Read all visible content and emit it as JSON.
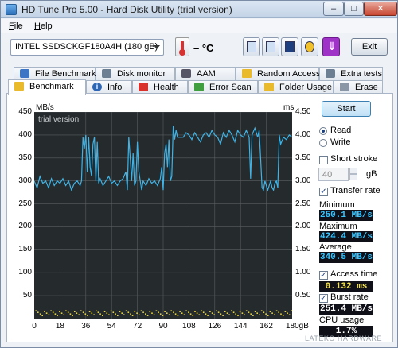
{
  "window": {
    "title": "HD Tune Pro 5.00 - Hard Disk Utility (trial version)",
    "minimize": "–",
    "maximize": "□",
    "close": "✕"
  },
  "menu": {
    "file": "File",
    "file_key": "F",
    "file_rest": "ile",
    "help_key": "H",
    "help_rest": "elp"
  },
  "toolbar": {
    "drive": "INTEL   SSDSCKGF180A4H (180 gB)",
    "temperature": "– °C",
    "exit_label": "Exit",
    "icons": [
      "copy-info-icon",
      "copy-screenshot-icon",
      "save-icon",
      "options-icon",
      "download-icon"
    ]
  },
  "tabs_top": [
    {
      "label": "File Benchmark",
      "icon": "file-benchmark-icon"
    },
    {
      "label": "Disk monitor",
      "icon": "disk-monitor-icon"
    },
    {
      "label": "AAM",
      "icon": "speaker-icon"
    },
    {
      "label": "Random Access",
      "icon": "random-access-icon"
    },
    {
      "label": "Extra tests",
      "icon": "extra-tests-icon"
    }
  ],
  "tabs_bottom": [
    {
      "label": "Benchmark",
      "icon": "benchmark-icon",
      "active": true
    },
    {
      "label": "Info",
      "icon": "info-icon"
    },
    {
      "label": "Health",
      "icon": "health-icon"
    },
    {
      "label": "Error Scan",
      "icon": "error-scan-icon"
    },
    {
      "label": "Folder Usage",
      "icon": "folder-icon"
    },
    {
      "label": "Erase",
      "icon": "erase-icon"
    }
  ],
  "controls": {
    "start": "Start",
    "read": "Read",
    "write": "Write",
    "read_selected": true,
    "short_stroke": "Short stroke",
    "short_stroke_checked": false,
    "stroke_value": "40",
    "stroke_unit": "gB",
    "transfer_rate": "Transfer rate",
    "transfer_rate_checked": true,
    "minimum_label": "Minimum",
    "minimum": "250.1 MB/s",
    "maximum_label": "Maximum",
    "maximum": "424.4 MB/s",
    "average_label": "Average",
    "average": "340.5 MB/s",
    "access_time": "Access time",
    "access_time_checked": true,
    "access_time_value": "0.132 ms",
    "burst_rate": "Burst rate",
    "burst_rate_checked": true,
    "burst_rate_value": "251.4 MB/s",
    "cpu_usage_label": "CPU usage",
    "cpu_usage": "1.7%"
  },
  "watermark": "LATEKO HARDWARE",
  "colors": {
    "plot_bg": "#252a2c",
    "grid": "#5a5f61",
    "transfer_line": "#3fb3e6",
    "access_dots": "#e6d23a"
  },
  "chart_data": {
    "type": "line",
    "overlay_text": "trial version",
    "y_left_label": "MB/s",
    "y_right_label": "ms",
    "x_unit": "gB",
    "x_ticks": [
      "0",
      "18",
      "36",
      "54",
      "72",
      "90",
      "108",
      "126",
      "144",
      "162",
      "180gB"
    ],
    "y_left_ticks": [
      "450",
      "400",
      "350",
      "300",
      "250",
      "200",
      "150",
      "100",
      "50"
    ],
    "y_right_ticks": [
      "4.50",
      "4.00",
      "3.50",
      "3.00",
      "2.50",
      "2.00",
      "1.50",
      "1.00",
      "0.50"
    ],
    "xlim": [
      0,
      180
    ],
    "ylim": [
      0,
      450
    ],
    "y2lim": [
      0,
      4.5
    ],
    "series": [
      {
        "name": "Transfer rate",
        "values": [
          [
            0,
            300
          ],
          [
            2,
            285
          ],
          [
            4,
            310
          ],
          [
            6,
            295
          ],
          [
            8,
            300
          ],
          [
            10,
            285
          ],
          [
            12,
            305
          ],
          [
            14,
            290
          ],
          [
            16,
            300
          ],
          [
            18,
            295
          ],
          [
            20,
            305
          ],
          [
            22,
            290
          ],
          [
            24,
            300
          ],
          [
            26,
            280
          ],
          [
            28,
            295
          ],
          [
            30,
            300
          ],
          [
            32,
            290
          ],
          [
            33,
            300
          ],
          [
            34,
            395
          ],
          [
            35,
            370
          ],
          [
            36,
            400
          ],
          [
            37,
            320
          ],
          [
            38,
            395
          ],
          [
            39,
            330
          ],
          [
            40,
            310
          ],
          [
            41,
            380
          ],
          [
            42,
            395
          ],
          [
            43,
            300
          ],
          [
            44,
            385
          ],
          [
            45,
            295
          ],
          [
            46,
            305
          ],
          [
            48,
            290
          ],
          [
            50,
            300
          ],
          [
            52,
            310
          ],
          [
            54,
            295
          ],
          [
            56,
            300
          ],
          [
            58,
            290
          ],
          [
            60,
            300
          ],
          [
            62,
            305
          ],
          [
            64,
            320
          ],
          [
            65,
            280
          ],
          [
            66,
            395
          ],
          [
            67,
            350
          ],
          [
            68,
            300
          ],
          [
            69,
            360
          ],
          [
            70,
            290
          ],
          [
            71,
            300
          ],
          [
            72,
            385
          ],
          [
            73,
            320
          ],
          [
            74,
            300
          ],
          [
            75,
            280
          ],
          [
            76,
            300
          ],
          [
            78,
            290
          ],
          [
            80,
            305
          ],
          [
            82,
            295
          ],
          [
            84,
            300
          ],
          [
            86,
            290
          ],
          [
            88,
            305
          ],
          [
            89,
            330
          ],
          [
            90,
            280
          ],
          [
            91,
            360
          ],
          [
            92,
            380
          ],
          [
            93,
            330
          ],
          [
            94,
            390
          ],
          [
            95,
            300
          ],
          [
            96,
            310
          ],
          [
            97,
            420
          ],
          [
            98,
            390
          ],
          [
            99,
            410
          ],
          [
            100,
            395
          ],
          [
            102,
            395
          ],
          [
            104,
            395
          ],
          [
            106,
            405
          ],
          [
            108,
            400
          ],
          [
            110,
            390
          ],
          [
            112,
            405
          ],
          [
            114,
            395
          ],
          [
            116,
            385
          ],
          [
            118,
            400
          ],
          [
            120,
            405
          ],
          [
            122,
            395
          ],
          [
            124,
            410
          ],
          [
            126,
            400
          ],
          [
            128,
            395
          ],
          [
            130,
            380
          ],
          [
            132,
            405
          ],
          [
            134,
            395
          ],
          [
            136,
            410
          ],
          [
            138,
            400
          ],
          [
            140,
            385
          ],
          [
            142,
            410
          ],
          [
            144,
            400
          ],
          [
            146,
            395
          ],
          [
            148,
            410
          ],
          [
            150,
            395
          ],
          [
            151,
            305
          ],
          [
            152,
            400
          ],
          [
            154,
            415
          ],
          [
            155,
            405
          ],
          [
            156,
            395
          ],
          [
            157,
            410
          ],
          [
            158,
            350
          ],
          [
            159,
            285
          ],
          [
            160,
            280
          ],
          [
            161,
            300
          ],
          [
            162,
            290
          ],
          [
            163,
            280
          ],
          [
            164,
            290
          ],
          [
            165,
            300
          ],
          [
            166,
            285
          ],
          [
            167,
            280
          ],
          [
            168,
            295
          ],
          [
            169,
            300
          ],
          [
            170,
            285
          ],
          [
            171,
            400
          ],
          [
            172,
            380
          ],
          [
            174,
            395
          ],
          [
            176,
            390
          ],
          [
            178,
            400
          ],
          [
            180,
            395
          ]
        ]
      },
      {
        "name": "Access time",
        "value_ms": 0.132
      }
    ]
  }
}
